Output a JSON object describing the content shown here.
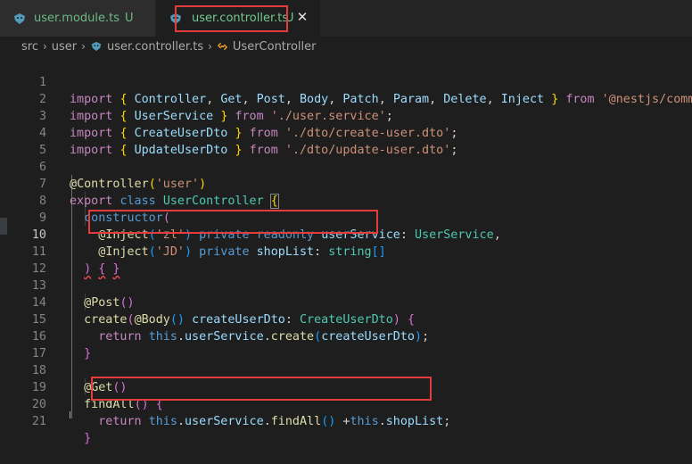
{
  "tabs": [
    {
      "name": "user.module.ts",
      "status": "U"
    },
    {
      "name": "user.controller.ts",
      "status": "U",
      "close": "✕"
    }
  ],
  "breadcrumb": {
    "parts": [
      "src",
      "user",
      "user.controller.ts",
      "UserController"
    ],
    "separator": "›"
  },
  "line_numbers": [
    "1",
    "2",
    "3",
    "4",
    "5",
    "6",
    "7",
    "8",
    "9",
    "10",
    "11",
    "12",
    "13",
    "14",
    "15",
    "16",
    "17",
    "18",
    "19",
    "20",
    "21"
  ],
  "code": {
    "l1": {
      "kw1": "import",
      "b1o": "{",
      "i1": "Controller",
      "c1": ",",
      "i2": "Get",
      "c2": ",",
      "i3": "Post",
      "c3": ",",
      "i4": "Body",
      "c4": ",",
      "i5": "Patch",
      "c5": ",",
      "i6": "Param",
      "c6": ",",
      "i7": "Delete",
      "c7": ",",
      "i8": "Inject",
      "b1c": "}",
      "kw2": "from",
      "s": "'@nestjs/common'",
      "semi": ";"
    },
    "l2": {
      "kw1": "import",
      "b1o": "{",
      "i1": "UserService",
      "b1c": "}",
      "kw2": "from",
      "s": "'./user.service'",
      "semi": ";"
    },
    "l3": {
      "kw1": "import",
      "b1o": "{",
      "i1": "CreateUserDto",
      "b1c": "}",
      "kw2": "from",
      "s": "'./dto/create-user.dto'",
      "semi": ";"
    },
    "l4": {
      "kw1": "import",
      "b1o": "{",
      "i1": "UpdateUserDto",
      "b1c": "}",
      "kw2": "from",
      "s": "'./dto/update-user.dto'",
      "semi": ";"
    },
    "l6": {
      "at": "@",
      "fn": "Controller",
      "po": "(",
      "s": "'user'",
      "pc": ")"
    },
    "l7": {
      "k1": "export",
      "k2": "class",
      "ty": "UserController",
      "bo": "{"
    },
    "l8": {
      "fn": "constructor",
      "po": "("
    },
    "l9": {
      "at": "@",
      "fn": "Inject",
      "po": "(",
      "s": "'zl'",
      "pc": ")",
      "k1": "private",
      "k2": "readonly",
      "id": "userService",
      "colon": ":",
      "ty": "UserService",
      "comma": ","
    },
    "l10": {
      "at": "@",
      "fn": "Inject",
      "po": "(",
      "s": "'JD'",
      "pc": ")",
      "k1": "private",
      "id": "shopList",
      "colon": ":",
      "ty": "string",
      "arr": "[]"
    },
    "l11": {
      "pc": ")",
      "bo": "{",
      "bc": "}"
    },
    "l13": {
      "at": "@",
      "fn": "Post",
      "pp": "()"
    },
    "l14": {
      "fn": "create",
      "po": "(",
      "at": "@",
      "fn2": "Body",
      "pp": "()",
      "id": "createUserDto",
      "colon": ":",
      "ty": "CreateUserDto",
      "pc": ")",
      "bo": "{"
    },
    "l15": {
      "kw": "return",
      "th": "this",
      "d1": ".",
      "id": "userService",
      "d2": ".",
      "fn": "create",
      "po": "(",
      "arg": "createUserDto",
      "pc": ")",
      "semi": ";"
    },
    "l16": {
      "bc": "}"
    },
    "l18": {
      "at": "@",
      "fn": "Get",
      "pp": "()"
    },
    "l19": {
      "fn": "findAll",
      "pp": "()",
      "bo": "{"
    },
    "l20": {
      "kw": "return",
      "th": "this",
      "d1": ".",
      "id": "userService",
      "d2": ".",
      "fn": "findAll",
      "pp": "()",
      "plus": "+",
      "th2": "this",
      "d3": ".",
      "id2": "shopList",
      "semi": ";"
    },
    "l21": {
      "bc": "}"
    }
  },
  "colors": {
    "accent_highlight": "#e23c3c",
    "untracked_file": "#73c991",
    "background": "#1e1e1e"
  },
  "icons": [
    "typescript-icon",
    "close-icon",
    "chevron-right-icon",
    "class-symbol-icon"
  ]
}
